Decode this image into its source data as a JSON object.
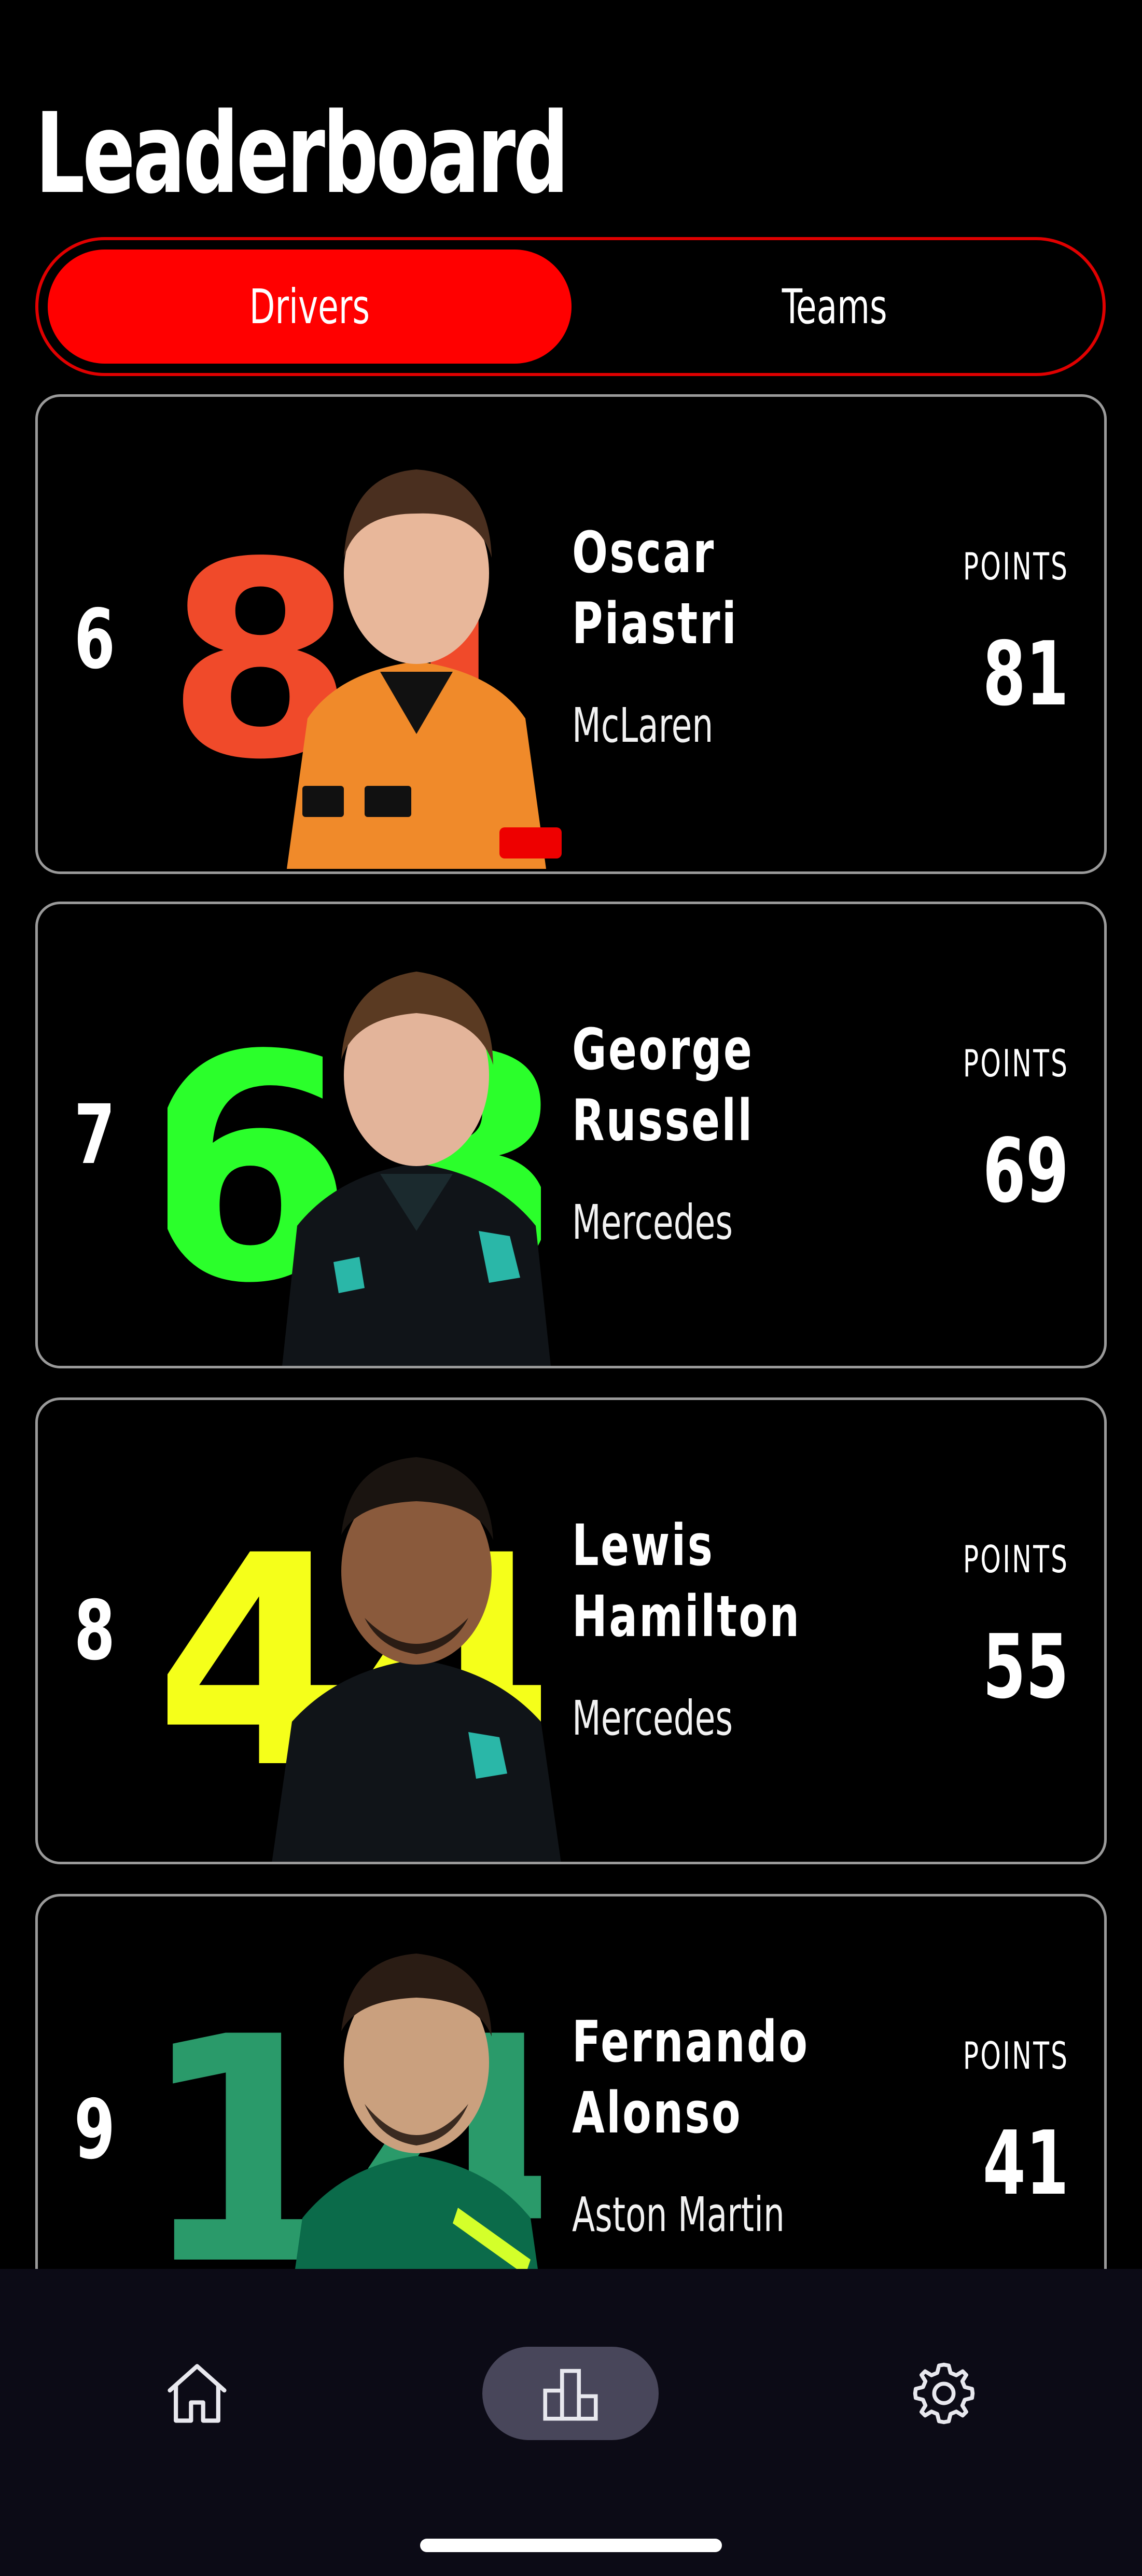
{
  "page": {
    "title": "Leaderboard"
  },
  "tabs": {
    "drivers": "Drivers",
    "teams": "Teams",
    "selected": "Drivers"
  },
  "drivers": [
    {
      "rank": "6",
      "first_name": "Oscar",
      "last_name": "Piastri",
      "team": "McLaren",
      "points_label": "POINTS",
      "points": "81",
      "car_number": "81",
      "number_color": "#f04a2a",
      "suit_color": "#f08a2a"
    },
    {
      "rank": "7",
      "first_name": "George",
      "last_name": "Russell",
      "team": "Mercedes",
      "points_label": "POINTS",
      "points": "69",
      "car_number": "63",
      "number_color": "#2bff2b",
      "suit_color": "#101418"
    },
    {
      "rank": "8",
      "first_name": "Lewis",
      "last_name": "Hamilton",
      "team": "Mercedes",
      "points_label": "POINTS",
      "points": "55",
      "car_number": "44",
      "number_color": "#f5ff1a",
      "suit_color": "#101418"
    },
    {
      "rank": "9",
      "first_name": "Fernando",
      "last_name": "Alonso",
      "team": "Aston Martin",
      "points_label": "POINTS",
      "points": "41",
      "car_number": "14",
      "number_color": "#2a9a6a",
      "suit_color": "#0b6b4a"
    }
  ],
  "nav": {
    "items": [
      {
        "icon": "home-icon",
        "active": false
      },
      {
        "icon": "leaderboard-icon",
        "active": true
      },
      {
        "icon": "settings-icon",
        "active": false
      }
    ]
  },
  "colors": {
    "accent": "#ff0000",
    "background": "#000000",
    "nav_background": "#0c0b16",
    "nav_active": "#48465a",
    "card_border": "#9a9a9a"
  }
}
